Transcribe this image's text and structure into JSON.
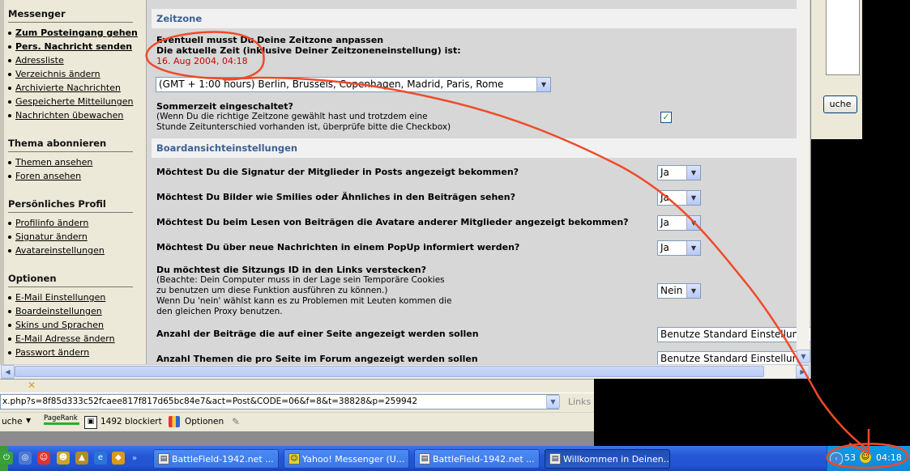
{
  "sidebar": {
    "sections": [
      {
        "title": "Messenger",
        "items": [
          "Zum Posteingang gehen",
          "Pers. Nachricht senden",
          "Adressliste",
          "Verzeichnis ändern",
          "Archivierte Nachrichten",
          "Gespeicherte Mitteilungen",
          "Nachrichten übewachen"
        ]
      },
      {
        "title": "Thema abonnieren",
        "items": [
          "Themen ansehen",
          "Foren ansehen"
        ]
      },
      {
        "title": "Persönliches Profil",
        "items": [
          "Profilinfo ändern",
          "Signatur ändern",
          "Avatareinstellungen"
        ]
      },
      {
        "title": "Optionen",
        "items": [
          "E-Mail Einstellungen",
          "Boardeinstellungen",
          "Skins und Sprachen",
          "E-Mail Adresse ändern",
          "Passwort ändern"
        ]
      }
    ]
  },
  "timezone": {
    "header": "Zeitzone",
    "line1": "Eventuell musst Du Deine Zeitzone anpassen",
    "line2": "Die aktuelle Zeit (inklusive Deiner Zeitzoneneinstellung) ist:",
    "current_time": "16. Aug 2004, 04:18",
    "selected": "(GMT + 1:00 hours) Berlin, Brussels, Copenhagen, Madrid, Paris, Rome",
    "dst_question": "Sommerzeit eingeschaltet?",
    "dst_note1": "(Wenn Du die richtige Zeitzone gewählt hast und trotzdem eine",
    "dst_note2": "Stunde Zeitunterschied vorhanden ist, überprüfe bitte die Checkbox)",
    "dst_checked": "✓"
  },
  "board": {
    "header": "Boardansichteinstellungen",
    "q1": "Möchtest Du die Signatur der Mitglieder in Posts angezeigt bekommen?",
    "q2": "Möchtest Du Bilder wie Smilies oder Ähnliches in den Beiträgen sehen?",
    "q3": "Möchtest Du beim Lesen von Beiträgen die Avatare anderer Mitglieder angezeigt bekommen?",
    "q4": "Möchtest Du über neue Nachrichten in einem PopUp informiert werden?",
    "a1": "Ja",
    "a2": "Ja",
    "a3": "Ja",
    "a4": "Ja",
    "sid_question": "Du möchtest die Sitzungs ID in den Links verstecken?",
    "sid_note1": "(Beachte: Dein Computer muss in der Lage sein Temporäre Cookies",
    "sid_note2": "zu benutzen um diese Funktion ausführen zu können.)",
    "sid_note3": "Wenn Du 'nein' wählst kann es zu Problemen mit Leuten kommen die",
    "sid_note4": "den gleichen Proxy benutzen.",
    "sid_answer": "Nein",
    "posts_question": "Anzahl der Beiträge die auf einer Seite angezeigt werden sollen",
    "posts_value": "Benutze Standard Einstellung",
    "topics_question": "Anzahl Themen die pro Seite im Forum angezeigt werden sollen",
    "topics_value": "Benutze Standard Einstellung"
  },
  "background_window": {
    "button": "uche"
  },
  "browser": {
    "address": "x.php?s=8f85d333c52fcaee817f817d65bc84e7&act=Post&CODE=06&f=8&t=38828&p=259942",
    "links_label": "Links",
    "search_label": "uche",
    "pagerank_label": "PageRank",
    "blocked_label": "1492 blockiert",
    "options_label": "Optionen"
  },
  "taskbar": {
    "buttons": [
      "BattleField-1942.net ...",
      "Yahoo! Messenger (U...",
      "BattleField-1942.net ...",
      "Willkommen in Deinen..."
    ],
    "tray_count": "53",
    "clock": "04:18"
  },
  "colors": {
    "annotation": "#f04a2a",
    "header_text": "#3a5f94",
    "time_red": "#cc0000"
  }
}
